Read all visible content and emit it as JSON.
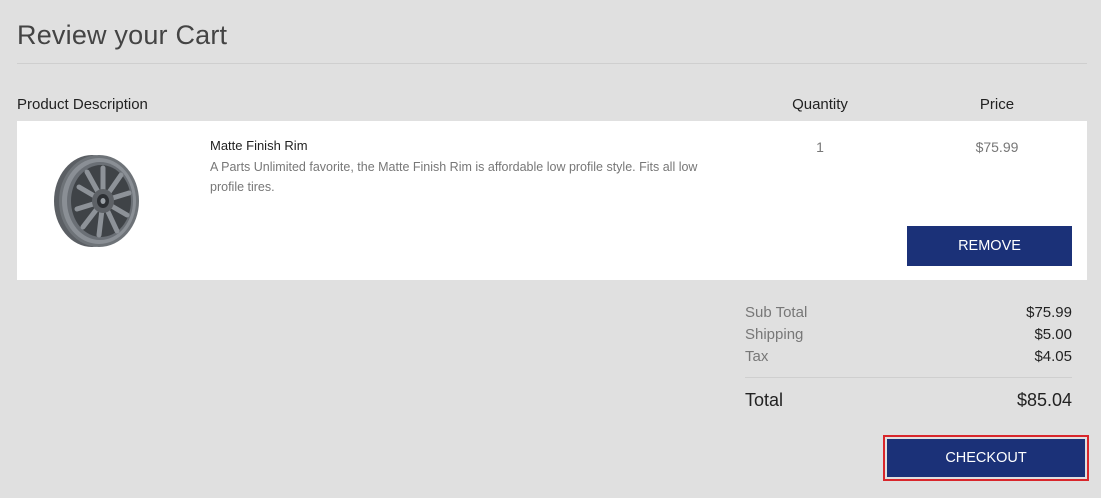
{
  "page": {
    "title": "Review your Cart"
  },
  "columns": {
    "description": "Product Description",
    "quantity": "Quantity",
    "price": "Price"
  },
  "item": {
    "name": "Matte Finish Rim",
    "description": "A Parts Unlimited favorite, the Matte Finish Rim is affordable low profile style. Fits all low profile tires.",
    "quantity": "1",
    "price": "$75.99",
    "remove_label": "REMOVE",
    "image_icon": "wheel-rim-image"
  },
  "summary": {
    "subtotal_label": "Sub Total",
    "subtotal_value": "$75.99",
    "shipping_label": "Shipping",
    "shipping_value": "$5.00",
    "tax_label": "Tax",
    "tax_value": "$4.05",
    "total_label": "Total",
    "total_value": "$85.04"
  },
  "checkout_label": "CHECKOUT",
  "colors": {
    "button_bg": "#1b3178",
    "highlight_border": "#d9262b",
    "background": "#e0e0e0"
  }
}
